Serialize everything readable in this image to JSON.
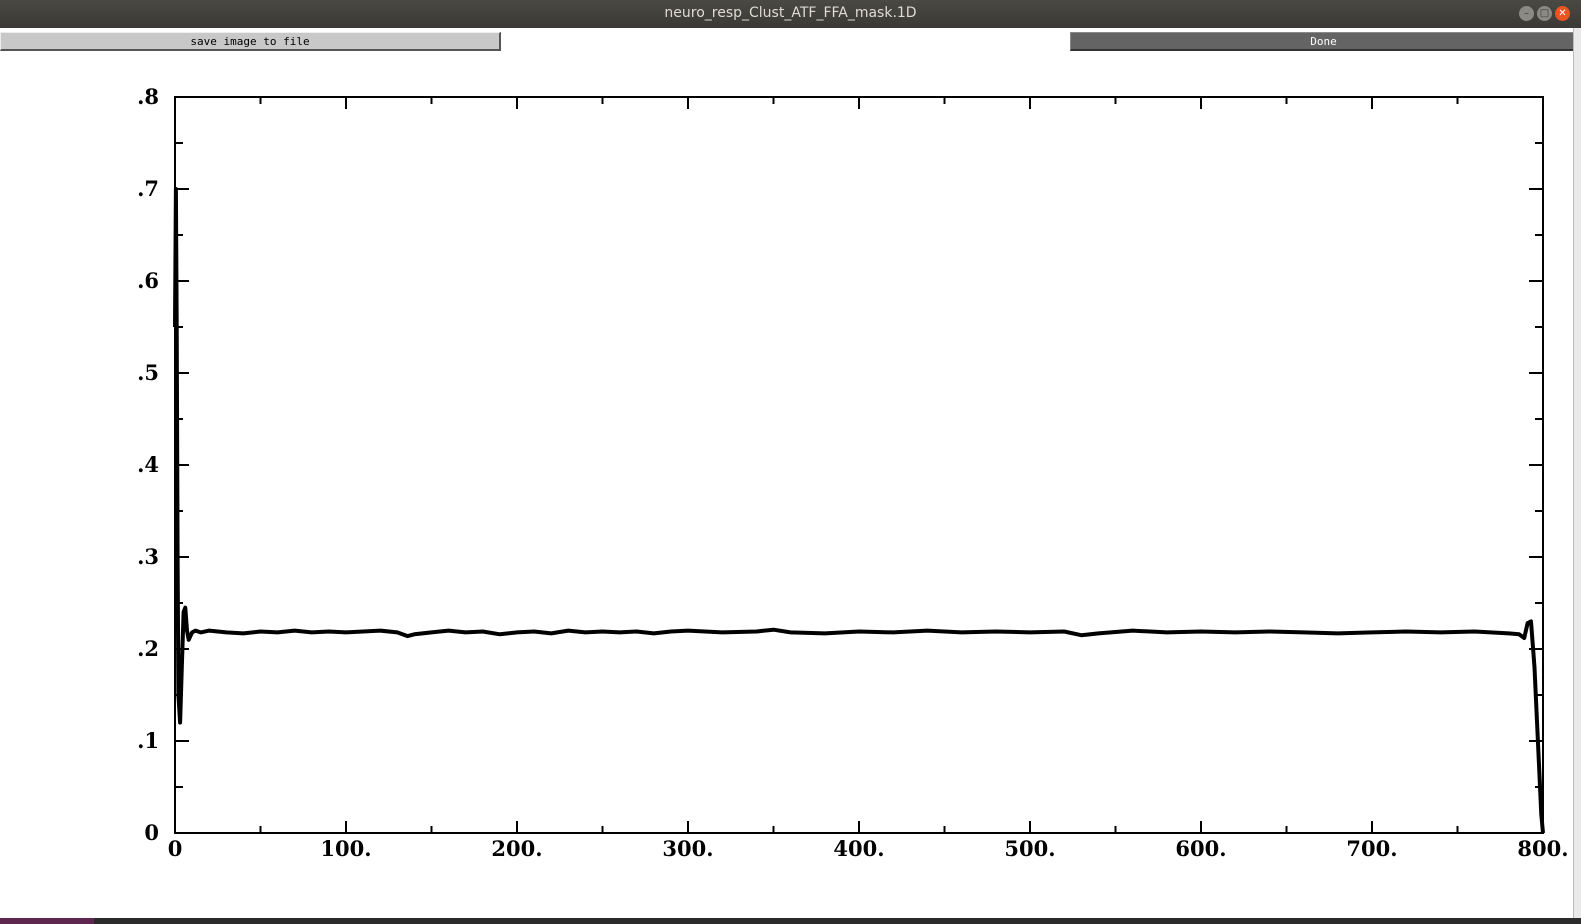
{
  "window": {
    "title": "neuro_resp_Clust_ATF_FFA_mask.1D",
    "controls": {
      "minimize": "–",
      "maximize": "□",
      "close": "✕"
    }
  },
  "toolbar": {
    "save_label": "save image to file",
    "done_label": "Done"
  },
  "colors": {
    "save_button_bg": "#c8c8c8",
    "done_button_bg": "#646464",
    "close_button": "#e95420",
    "titlebar": "#3a3935"
  },
  "chart_data": {
    "type": "line",
    "title": "",
    "xlabel": "",
    "ylabel": "",
    "xlim": [
      0,
      800
    ],
    "ylim": [
      0,
      0.8
    ],
    "x_ticks": [
      "0",
      "100.",
      "200.",
      "300.",
      "400.",
      "500.",
      "600.",
      "700.",
      "800."
    ],
    "y_ticks": [
      "0",
      ".1",
      ".2",
      ".3",
      ".4",
      ".5",
      ".6",
      ".7",
      ".8"
    ],
    "grid": false,
    "series": [
      {
        "x": [
          0,
          0.5,
          1,
          1.5,
          2,
          3,
          4,
          5,
          6,
          7,
          8,
          10,
          12,
          15,
          20,
          30,
          40,
          50,
          60,
          70,
          80,
          90,
          100,
          110,
          120,
          130,
          136,
          140,
          150,
          160,
          170,
          180,
          190,
          200,
          210,
          220,
          230,
          240,
          250,
          260,
          270,
          280,
          290,
          300,
          320,
          340,
          350,
          360,
          380,
          400,
          420,
          440,
          460,
          480,
          500,
          520,
          530,
          540,
          560,
          580,
          600,
          620,
          640,
          660,
          680,
          700,
          720,
          740,
          760,
          780,
          786,
          789,
          791,
          793,
          795,
          797,
          799,
          800
        ],
        "y": [
          0.55,
          0.7,
          0.55,
          0.3,
          0.15,
          0.12,
          0.18,
          0.24,
          0.245,
          0.22,
          0.21,
          0.218,
          0.22,
          0.218,
          0.22,
          0.218,
          0.217,
          0.219,
          0.218,
          0.22,
          0.218,
          0.219,
          0.218,
          0.219,
          0.22,
          0.218,
          0.214,
          0.216,
          0.218,
          0.22,
          0.218,
          0.219,
          0.216,
          0.218,
          0.219,
          0.217,
          0.22,
          0.218,
          0.219,
          0.218,
          0.219,
          0.217,
          0.219,
          0.22,
          0.218,
          0.219,
          0.221,
          0.218,
          0.217,
          0.219,
          0.218,
          0.22,
          0.218,
          0.219,
          0.218,
          0.219,
          0.215,
          0.217,
          0.22,
          0.218,
          0.219,
          0.218,
          0.219,
          0.218,
          0.217,
          0.218,
          0.219,
          0.218,
          0.219,
          0.217,
          0.216,
          0.212,
          0.228,
          0.23,
          0.18,
          0.1,
          0.02,
          0.0
        ]
      }
    ]
  }
}
